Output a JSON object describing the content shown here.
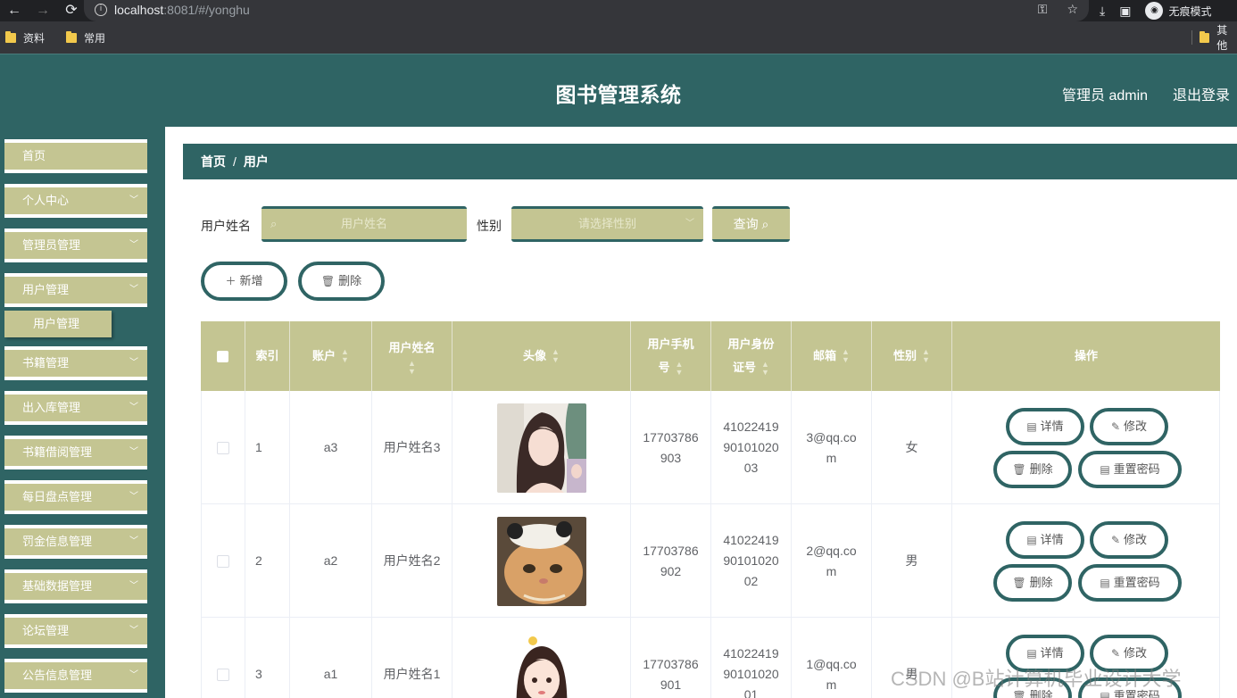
{
  "browser": {
    "url_host": "localhost",
    "url_path": ":8081/#/yonghu",
    "incognito_label": "无痕模式",
    "bookmarks": [
      "资料",
      "常用"
    ],
    "bookmark_more": "其他"
  },
  "header": {
    "title": "图书管理系统",
    "user": "管理员 admin",
    "logout": "退出登录"
  },
  "sidebar": {
    "items": [
      {
        "label": "首页",
        "expandable": false
      },
      {
        "label": "个人中心",
        "expandable": true
      },
      {
        "label": "管理员管理",
        "expandable": true
      },
      {
        "label": "用户管理",
        "expandable": true
      },
      {
        "label": "书籍管理",
        "expandable": true
      },
      {
        "label": "出入库管理",
        "expandable": true
      },
      {
        "label": "书籍借阅管理",
        "expandable": true
      },
      {
        "label": "每日盘点管理",
        "expandable": true
      },
      {
        "label": "罚金信息管理",
        "expandable": true
      },
      {
        "label": "基础数据管理",
        "expandable": true
      },
      {
        "label": "论坛管理",
        "expandable": true
      },
      {
        "label": "公告信息管理",
        "expandable": true
      }
    ],
    "sub_item": "用户管理"
  },
  "breadcrumb": {
    "home": "首页",
    "sep": "/",
    "current": "用户"
  },
  "search": {
    "name_label": "用户姓名",
    "name_placeholder": "用户姓名",
    "gender_label": "性别",
    "gender_placeholder": "请选择性别",
    "query_button": "查询"
  },
  "actions": {
    "add": "新增",
    "delete": "删除"
  },
  "table": {
    "headers": {
      "index": "索引",
      "account": "账户",
      "name": "用户姓名",
      "avatar": "头像",
      "phone": "用户手机号",
      "idcard": "用户身份证号",
      "email": "邮箱",
      "gender": "性别",
      "ops": "操作"
    },
    "row_buttons": {
      "detail": "详情",
      "edit": "修改",
      "delete": "删除",
      "reset": "重置密码"
    },
    "rows": [
      {
        "index": "1",
        "account": "a3",
        "name": "用户姓名3",
        "phone": "17703786903",
        "idcard": "410224199010102003",
        "email": "3@qq.com",
        "gender": "女"
      },
      {
        "index": "2",
        "account": "a2",
        "name": "用户姓名2",
        "phone": "17703786902",
        "idcard": "410224199010102002",
        "email": "2@qq.com",
        "gender": "男"
      },
      {
        "index": "3",
        "account": "a1",
        "name": "用户姓名1",
        "phone": "17703786901",
        "idcard": "410224199010102001",
        "email": "1@qq.com",
        "gender": "男"
      }
    ]
  },
  "watermark": "CSDN @B站计算机毕业设计大学",
  "colors": {
    "primary": "#2f6464",
    "accent": "#c4c592"
  }
}
